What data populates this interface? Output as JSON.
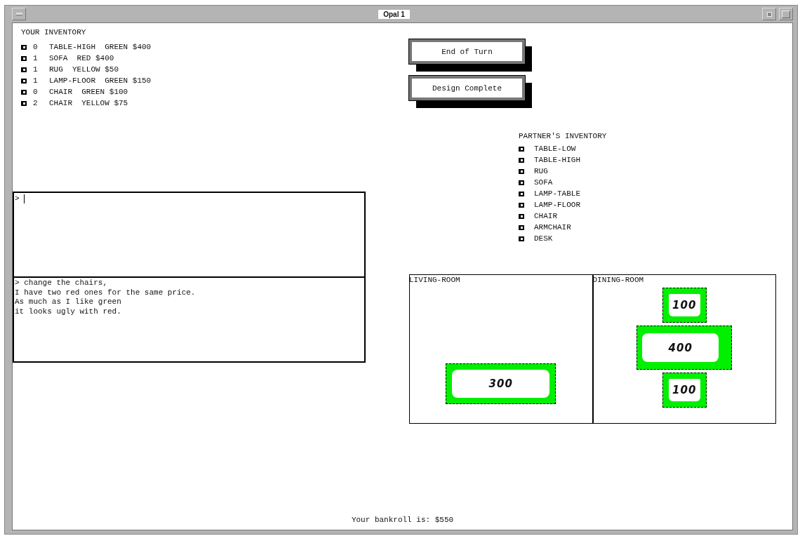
{
  "window": {
    "title": "Opal 1"
  },
  "your_inventory": {
    "title": "YOUR INVENTORY",
    "items": [
      {
        "count": "0",
        "text": "TABLE-HIGH  GREEN $400"
      },
      {
        "count": "1",
        "text": "SOFA  RED $400"
      },
      {
        "count": "1",
        "text": "RUG  YELLOW $50"
      },
      {
        "count": "1",
        "text": "LAMP-FLOOR  GREEN $150"
      },
      {
        "count": "0",
        "text": "CHAIR  GREEN $100"
      },
      {
        "count": "2",
        "text": "CHAIR  YELLOW $75"
      }
    ]
  },
  "input": {
    "prompt": ">"
  },
  "transcript": [
    "> change the chairs,",
    "I have two red ones for the same price.",
    "As much as I like green",
    "it looks ugly with red."
  ],
  "buttons": [
    "End of Turn",
    "Design Complete"
  ],
  "partner_inventory": {
    "title": "PARTNER'S INVENTORY",
    "items": [
      "TABLE-LOW",
      "TABLE-HIGH",
      "RUG",
      "SOFA",
      "LAMP-TABLE",
      "LAMP-FLOOR",
      "CHAIR",
      "ARMCHAIR",
      "DESK"
    ]
  },
  "rooms": [
    {
      "name": "LIVING-ROOM",
      "items": [
        {
          "kind": "sofa",
          "label": "300"
        }
      ]
    },
    {
      "name": "DINING-ROOM",
      "items": [
        {
          "kind": "chair",
          "label": "100"
        },
        {
          "kind": "table",
          "label": "400"
        },
        {
          "kind": "chair",
          "label": "100"
        }
      ]
    }
  ],
  "status": "Your bankroll is: $550"
}
